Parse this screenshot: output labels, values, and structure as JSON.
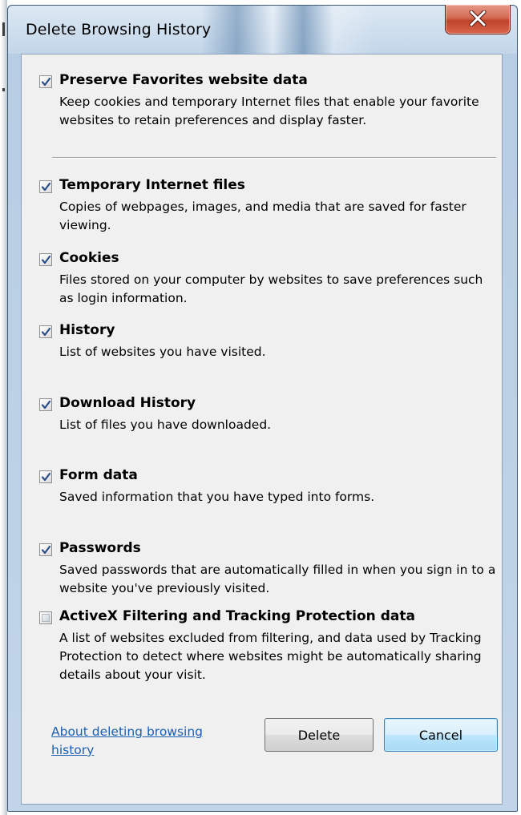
{
  "window": {
    "title": "Delete Browsing History",
    "close_icon": "close-x-icon",
    "colors": {
      "frame": "#b7cde3",
      "close": "#c0432a",
      "link": "#1a5fb4",
      "panel": "#f0f0f0"
    }
  },
  "options": [
    {
      "label": "Preserve Favorites website data",
      "description": "Keep cookies and temporary Internet files that enable your favorite websites to retain preferences and display faster.",
      "checked": true
    },
    {
      "label": "Temporary Internet files",
      "description": "Copies of webpages, images, and media that are saved for faster viewing.",
      "checked": true
    },
    {
      "label": "Cookies",
      "description": "Files stored on your computer by websites to save preferences such as login information.",
      "checked": true
    },
    {
      "label": "History",
      "description": "List of websites you have visited.",
      "checked": true
    },
    {
      "label": "Download History",
      "description": "List of files you have downloaded.",
      "checked": true
    },
    {
      "label": "Form data",
      "description": "Saved information that you have typed into forms.",
      "checked": true
    },
    {
      "label": "Passwords",
      "description": "Saved passwords that are automatically filled in when you sign in to a website you've previously visited.",
      "checked": true
    },
    {
      "label": "ActiveX Filtering and Tracking Protection data",
      "description": "A list of websites excluded from filtering, and data used by Tracking Protection to detect where websites might be automatically sharing details about your visit.",
      "checked": false
    }
  ],
  "footer": {
    "about_link": "About deleting browsing history",
    "delete_label": "Delete",
    "cancel_label": "Cancel"
  }
}
